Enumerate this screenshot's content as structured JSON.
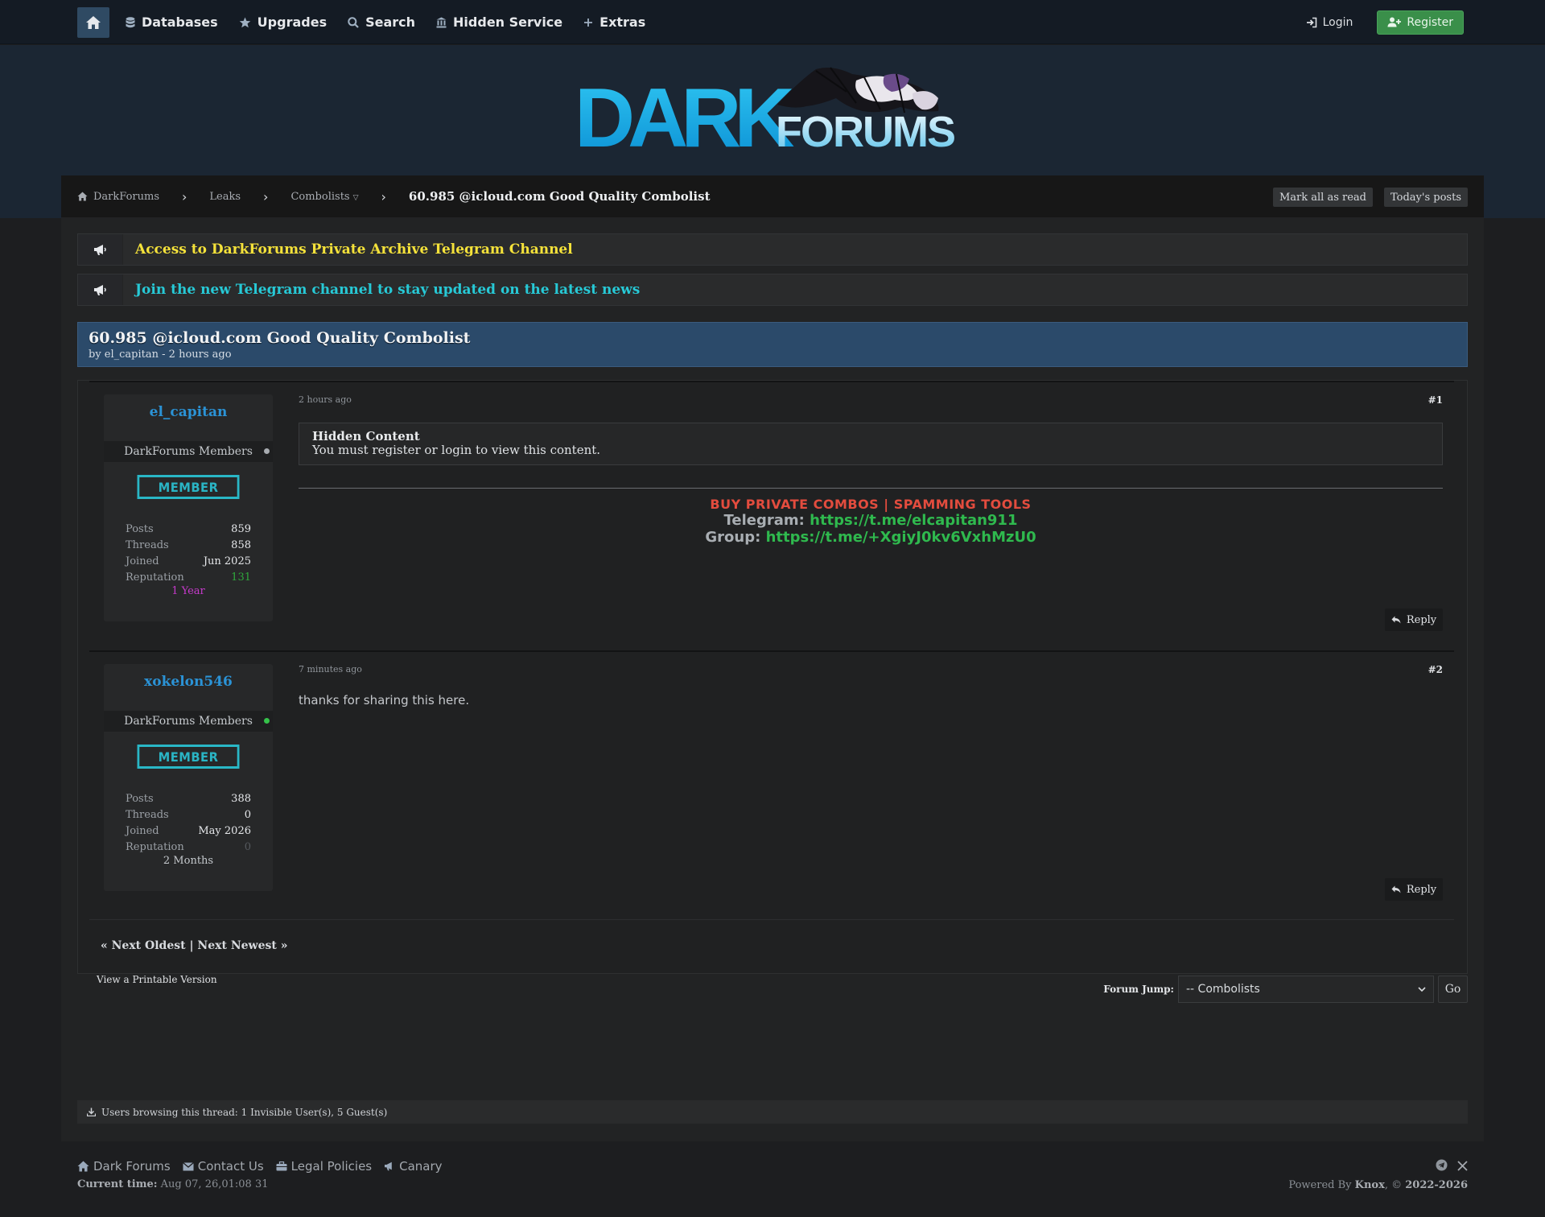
{
  "nav": {
    "items": [
      {
        "label": "Databases",
        "icon": "database-icon"
      },
      {
        "label": "Upgrades",
        "icon": "star-icon"
      },
      {
        "label": "Search",
        "icon": "search-icon"
      },
      {
        "label": "Hidden Service",
        "icon": "institution-icon"
      },
      {
        "label": "Extras",
        "icon": "plus-icon"
      }
    ],
    "login": "Login",
    "register": "Register"
  },
  "logo": {
    "word1": "DARK",
    "word2": "FORUMS"
  },
  "breadcrumb": {
    "home": "DarkForums",
    "leaks": "Leaks",
    "combolists": "Combolists",
    "current": "60.985 @icloud.com Good Quality Combolist",
    "mark_read": "Mark all as read",
    "todays_posts": "Today's posts"
  },
  "announcements": [
    {
      "text": "Access to DarkForums Private Archive Telegram Channel",
      "color": "#f5e23a"
    },
    {
      "text": "Join the new Telegram channel to stay updated on the latest news",
      "color": "#27c9d6"
    }
  ],
  "thread": {
    "title": "60.985 @icloud.com Good Quality Combolist",
    "subtitle": "by el_capitan - 2 hours ago"
  },
  "posts": [
    {
      "author": "el_capitan",
      "group": "DarkForums Members",
      "rank": "MEMBER",
      "stats": [
        {
          "k": "Posts",
          "v": "859"
        },
        {
          "k": "Threads",
          "v": "858"
        },
        {
          "k": "Joined",
          "v": "Jun 2025"
        },
        {
          "k": "Reputation",
          "v": "131"
        }
      ],
      "tenure": "1 Year",
      "time": "2 hours ago",
      "number": "#1",
      "hidden_title": "Hidden Content",
      "hidden_text": "You must register or login to view this content.",
      "sig_line1": "BUY PRIVATE COMBOS | SPAMMING TOOLS",
      "sig_telegram_label": "Telegram:",
      "sig_telegram_link": "https://t.me/elcapitan911",
      "sig_group_label": "Group:",
      "sig_group_link": "https://t.me/+XgiyJ0kv6VxhMzU0",
      "reply": "Reply"
    },
    {
      "author": "xokelon546",
      "group": "DarkForums Members",
      "rank": "MEMBER",
      "stats": [
        {
          "k": "Posts",
          "v": "388"
        },
        {
          "k": "Threads",
          "v": "0"
        },
        {
          "k": "Joined",
          "v": "May 2026"
        },
        {
          "k": "Reputation",
          "v": "0"
        }
      ],
      "tenure": "2 Months",
      "time": "7 minutes ago",
      "number": "#2",
      "text": "thanks for sharing this here.",
      "reply": "Reply"
    }
  ],
  "pager": {
    "prev": "« Next Oldest",
    "sep": "|",
    "next": "Next Newest »"
  },
  "printable": "View a Printable Version",
  "forum_jump": {
    "label": "Forum Jump:",
    "selected": "-- Combolists",
    "go": "Go"
  },
  "browsing": "Users browsing this thread: 1 Invisible User(s), 5 Guest(s)",
  "footer": {
    "links": [
      "Dark Forums",
      "Contact Us",
      "Legal Policies",
      "Canary"
    ],
    "time_label": "Current time:",
    "time_value": "Aug 07, 26,01:08 31",
    "powered_prefix": "Powered By",
    "powered_name": "Knox",
    "powered_suffix": ", ©",
    "powered_years": "2022-2026"
  },
  "colors": {
    "accent": "#2b4a6a",
    "link_blue": "#2b93d6",
    "green": "#2fb94e",
    "red": "#e34c3e",
    "rank": "#29b7c6"
  }
}
